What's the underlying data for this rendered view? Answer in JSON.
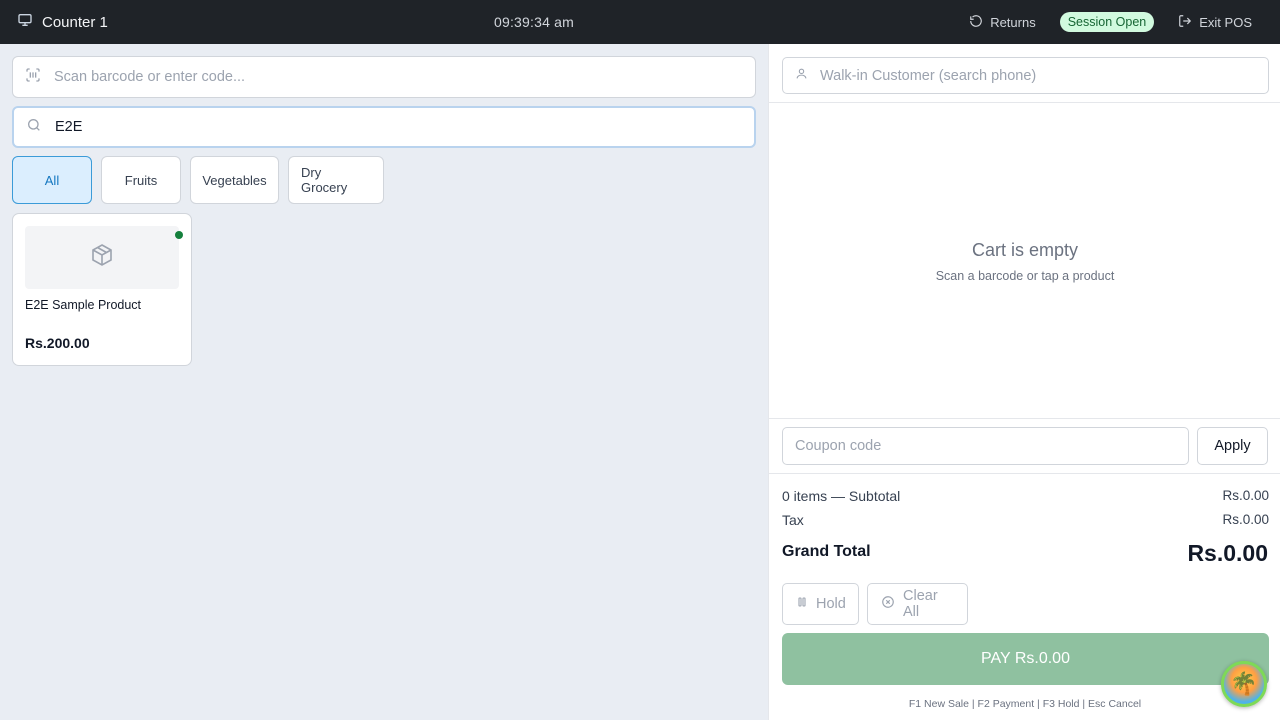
{
  "topbar": {
    "title": "Counter 1",
    "clock": "09:39:34 am",
    "returns_label": "Returns",
    "session_badge": "Session Open",
    "exit_label": "Exit POS"
  },
  "left": {
    "scan_placeholder": "Scan barcode or enter code...",
    "search_value": "E2E",
    "categories": [
      "All",
      "Fruits",
      "Vegetables",
      "Dry Grocery"
    ],
    "active_category": "All",
    "products": [
      {
        "name": "E2E Sample Product",
        "price": "Rs.200.00",
        "in_stock": true
      }
    ]
  },
  "cart": {
    "customer_placeholder": "Walk-in Customer (search phone)",
    "empty_title": "Cart is empty",
    "empty_subtitle": "Scan a barcode or tap a product",
    "coupon_placeholder": "Coupon code",
    "apply_label": "Apply",
    "subtotal_label": "0 items — Subtotal",
    "subtotal_value": "Rs.0.00",
    "tax_label": "Tax",
    "tax_value": "Rs.0.00",
    "grand_total_label": "Grand Total",
    "grand_total_value": "Rs.0.00",
    "hold_label": "Hold",
    "clear_label": "Clear All",
    "pay_label": "PAY Rs.0.00",
    "shortcuts": "F1 New Sale | F2 Payment | F3 Hold | Esc Cancel"
  },
  "colors": {
    "topbar_bg": "#1f2328",
    "accent": "#1477c0",
    "session_badge_bg": "#d1fadf",
    "pay_button": "#8fc1a0",
    "stock_dot": "#15803d"
  },
  "icons": [
    "monitor-icon",
    "rotate-ccw-icon",
    "log-out-icon",
    "barcode-scan-icon",
    "search-icon",
    "package-icon",
    "user-icon",
    "pause-icon",
    "x-circle-icon",
    "assistant-avatar-icon"
  ]
}
